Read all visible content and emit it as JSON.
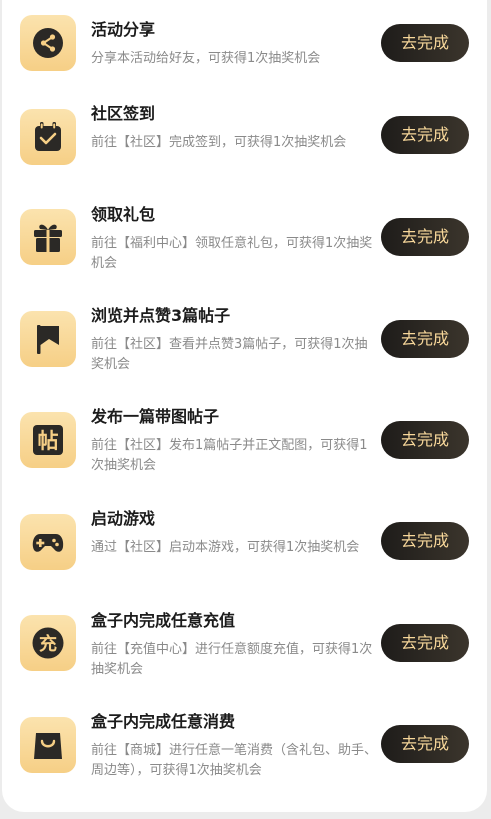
{
  "tasks": [
    {
      "icon": "share-icon",
      "title": "活动分享",
      "desc": "分享本活动给好友，可获得1次抽奖机会",
      "button": "去完成"
    },
    {
      "icon": "calendar-check-icon",
      "title": "社区签到",
      "desc": "前往【社区】完成签到，可获得1次抽奖机会",
      "button": "去完成"
    },
    {
      "icon": "gift-icon",
      "title": "领取礼包",
      "desc": "前往【福利中心】领取任意礼包，可获得1次抽奖机会",
      "button": "去完成"
    },
    {
      "icon": "flag-icon",
      "title": "浏览并点赞3篇帖子",
      "desc": "前往【社区】查看并点赞3篇帖子，可获得1次抽奖机会",
      "button": "去完成"
    },
    {
      "icon": "post-icon",
      "icon_text": "帖",
      "title": "发布一篇带图帖子",
      "desc": "前往【社区】发布1篇帖子并正文配图，可获得1次抽奖机会",
      "button": "去完成"
    },
    {
      "icon": "gamepad-icon",
      "title": "启动游戏",
      "desc": "通过【社区】启动本游戏，可获得1次抽奖机会",
      "button": "去完成"
    },
    {
      "icon": "recharge-icon",
      "icon_text": "充",
      "title": "盒子内完成任意充值",
      "desc": "前往【充值中心】进行任意额度充值，可获得1次抽奖机会",
      "button": "去完成"
    },
    {
      "icon": "shopping-bag-icon",
      "title": "盒子内完成任意消费",
      "desc": "前往【商城】进行任意一笔消费（含礼包、助手、周边等），可获得1次抽奖机会",
      "button": "去完成"
    }
  ],
  "colors": {
    "icon_bg_top": "#fbe3ae",
    "icon_bg_bottom": "#f6cf86",
    "icon_glyph": "#2b2926",
    "button_bg": "#1e1c1a",
    "button_text": "#f7d79a"
  }
}
